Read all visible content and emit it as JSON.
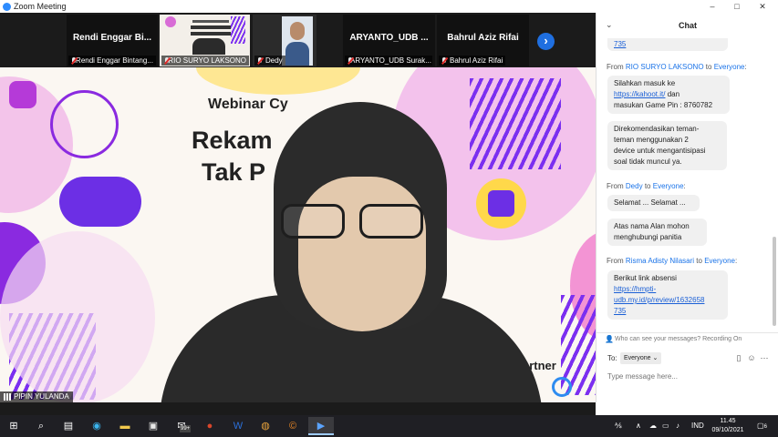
{
  "window": {
    "title": "Zoom Meeting",
    "controls": {
      "minimize": "–",
      "maximize": "□",
      "close": "✕"
    }
  },
  "participants": [
    {
      "name": "Rendi Enggar Bi...",
      "label": "Rendi Enggar Bintang...",
      "muted": true,
      "video": false
    },
    {
      "name": "",
      "label": "RIO SURYO LAKSONO",
      "muted": true,
      "video": true
    },
    {
      "name": "",
      "label": "Dedy",
      "muted": true,
      "video": true
    },
    {
      "name": "ARYANTO_UDB ...",
      "label": "ARYANTO_UDB Surak...",
      "muted": true,
      "video": false
    },
    {
      "name": "Bahrul Aziz Rifai",
      "label": "Bahrul Aziz Rifai",
      "muted": true,
      "video": false
    }
  ],
  "next_button": "›",
  "stage": {
    "webinar_line": "Webinar Cy",
    "headline_1": "Rekam",
    "headline_2": "Tak P",
    "partner_text": "artner",
    "speaker": "PIPIN YULANDA",
    "colors": {
      "purple": "#7b2ff0",
      "pink": "#f06ac8",
      "blue": "#2e8cf0",
      "yellow": "#ffd84a"
    }
  },
  "chat": {
    "title": "Chat",
    "collapse_icon": "chevron-down-icon",
    "messages": [
      {
        "sender": "",
        "to": "",
        "lines": [
          "735"
        ]
      },
      {
        "sender": "RIO SURYO LAKSONO",
        "to": "Everyone",
        "lines": [
          "Silahkan masuk ke",
          "https://kahoot.it/",
          " dan",
          "masukan Game Pin : 8760782"
        ]
      },
      {
        "sender": "",
        "to": "",
        "lines": [
          "Direkomendasikan teman-",
          "teman menggunakan 2",
          "device untuk mengantisipasi",
          "soal tidak muncul ya."
        ]
      },
      {
        "sender": "Dedy",
        "to": "Everyone",
        "lines": [
          "Selamat ... Selamat ..."
        ]
      },
      {
        "sender": "",
        "to": "",
        "lines": [
          "Atas nama Alan mohon",
          "menghubungi panitia"
        ]
      },
      {
        "sender": "Risma Adisty Nilasari",
        "to": "Everyone",
        "lines": [
          "Berikut link absensi",
          "https://hmpti-",
          "udb.my.id/p/review/1632658",
          "735"
        ]
      }
    ],
    "from_word": "From",
    "to_word": "to",
    "privacy_note": "Who can see your messages? Recording On",
    "to_label": "To:",
    "recipient": "Everyone",
    "input_placeholder": "Type message here..."
  },
  "taskbar": {
    "apps": [
      "start",
      "search",
      "task-view",
      "edge",
      "file-explorer",
      "store",
      "mail",
      "powerpoint",
      "word",
      "chrome",
      "app-c",
      "zoom"
    ],
    "mail_badge": "99+",
    "lang": "IND",
    "time": "11.45",
    "date": "09/10/2021",
    "notification_count": "6"
  }
}
